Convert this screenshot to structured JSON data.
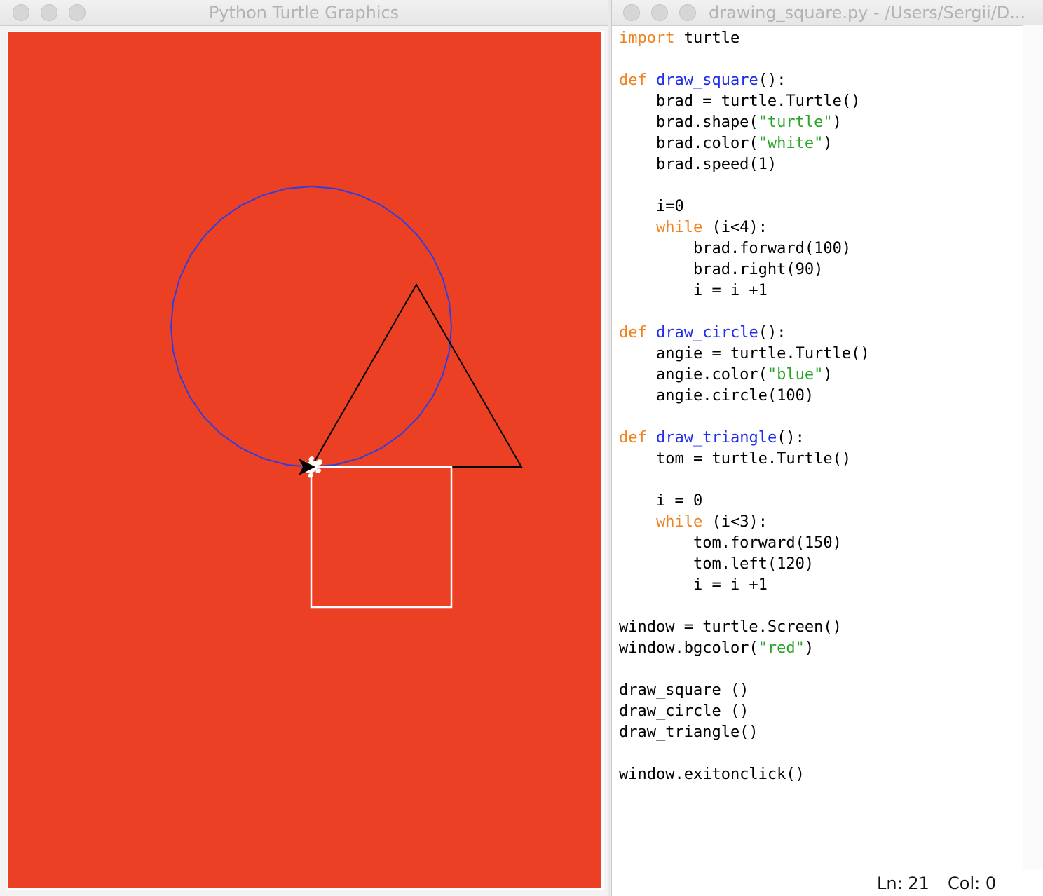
{
  "turtle_window": {
    "title": "Python Turtle Graphics",
    "canvas_bg": "#ec4024"
  },
  "editor_window": {
    "title": "drawing_square.py - /Users/Sergii/D...",
    "code_lines": [
      [
        [
          "kw",
          "import"
        ],
        [
          "",
          " turtle"
        ]
      ],
      [],
      [
        [
          "kw",
          "def"
        ],
        [
          "",
          " "
        ],
        [
          "fn",
          "draw_square"
        ],
        [
          "",
          "():"
        ]
      ],
      [
        [
          "",
          "    brad = turtle.Turtle()"
        ]
      ],
      [
        [
          "",
          "    brad.shape("
        ],
        [
          "str",
          "\"turtle\""
        ],
        [
          "",
          ")"
        ]
      ],
      [
        [
          "",
          "    brad.color("
        ],
        [
          "str",
          "\"white\""
        ],
        [
          "",
          ")"
        ]
      ],
      [
        [
          "",
          "    brad.speed(1)"
        ]
      ],
      [],
      [
        [
          "",
          "    i=0"
        ]
      ],
      [
        [
          "",
          "    "
        ],
        [
          "kw",
          "while"
        ],
        [
          "",
          " (i<4):"
        ]
      ],
      [
        [
          "",
          "        brad.forward(100)"
        ]
      ],
      [
        [
          "",
          "        brad.right(90)"
        ]
      ],
      [
        [
          "",
          "        i = i +1"
        ]
      ],
      [],
      [
        [
          "kw",
          "def"
        ],
        [
          "",
          " "
        ],
        [
          "fn",
          "draw_circle"
        ],
        [
          "",
          "():"
        ]
      ],
      [
        [
          "",
          "    angie = turtle.Turtle()"
        ]
      ],
      [
        [
          "",
          "    angie.color("
        ],
        [
          "str",
          "\"blue\""
        ],
        [
          "",
          ")"
        ]
      ],
      [
        [
          "",
          "    angie.circle(100)"
        ]
      ],
      [],
      [
        [
          "kw",
          "def"
        ],
        [
          "",
          " "
        ],
        [
          "fn",
          "draw_triangle"
        ],
        [
          "",
          "():"
        ]
      ],
      [
        [
          "",
          "    tom = turtle.Turtle()"
        ]
      ],
      [],
      [
        [
          "",
          "    i = 0"
        ]
      ],
      [
        [
          "",
          "    "
        ],
        [
          "kw",
          "while"
        ],
        [
          "",
          " (i<3):"
        ]
      ],
      [
        [
          "",
          "        tom.forward(150)"
        ]
      ],
      [
        [
          "",
          "        tom.left(120)"
        ]
      ],
      [
        [
          "",
          "        i = i +1"
        ]
      ],
      [],
      [
        [
          "",
          "window = turtle.Screen()"
        ]
      ],
      [
        [
          "",
          "window.bgcolor("
        ],
        [
          "str",
          "\"red\""
        ],
        [
          "",
          ")"
        ]
      ],
      [],
      [
        [
          "",
          "draw_square ()"
        ]
      ],
      [
        [
          "",
          "draw_circle ()"
        ]
      ],
      [
        [
          "",
          "draw_triangle()"
        ]
      ],
      [],
      [
        [
          "",
          "window.exitonclick()"
        ]
      ]
    ],
    "status": {
      "line": "Ln: 21",
      "col": "Col: 0"
    }
  },
  "colors": {
    "keyword": "#f0821e",
    "function": "#1e2eea",
    "string": "#2aa52a",
    "circle": "#2e3fe0",
    "square": "#ffffff",
    "triangle": "#000000"
  }
}
